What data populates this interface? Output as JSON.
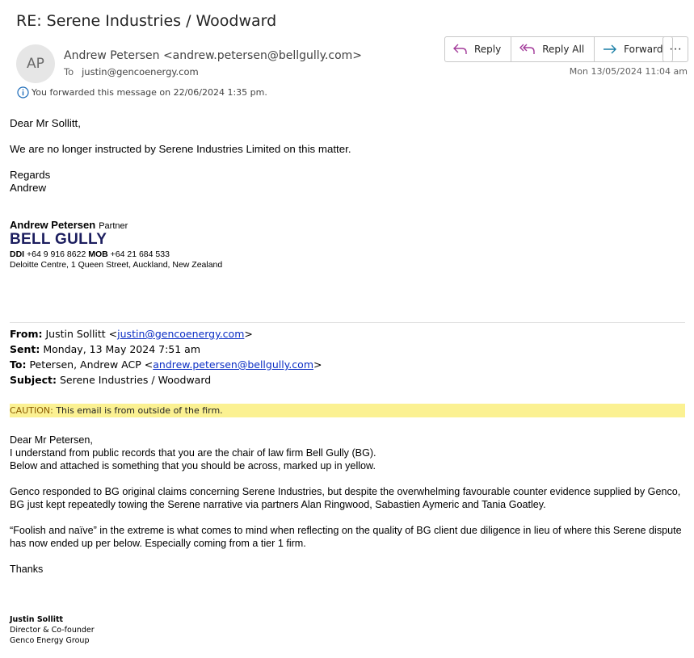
{
  "email": {
    "subject": "RE: Serene Industries / Woodward",
    "avatar_initials": "AP",
    "sender": "Andrew Petersen <andrew.petersen@bellgully.com>",
    "to_label": "To",
    "to": "justin@gencoenergy.com",
    "date": "Mon 13/05/2024 11:04 am",
    "info": "You forwarded this message on 22/06/2024 1:35 pm."
  },
  "toolbar": {
    "reply": "Reply",
    "reply_all": "Reply All",
    "forward": "Forward",
    "more": "···"
  },
  "body": {
    "greeting": "Dear Mr Sollitt,",
    "line1": "We are no longer instructed by Serene Industries Limited on this matter.",
    "regards": "Regards",
    "name": "Andrew"
  },
  "signature": {
    "name": "Andrew Petersen",
    "role": "Partner",
    "brand": "BELL GULLY",
    "ddi_label": "DDI",
    "ddi": "+64 9 916 8622",
    "mob_label": "MOB",
    "mob": "+64 21 684 533",
    "address": "Deloitte Centre, 1 Queen Street, Auckland, New Zealand"
  },
  "quoted": {
    "from_label": "From:",
    "from_name": "Justin Sollitt <",
    "from_email": "justin@gencoenergy.com",
    "from_end": ">",
    "sent_label": "Sent:",
    "sent": "Monday, 13 May 2024 7:51 am",
    "to_label": "To:",
    "to_name": "Petersen, Andrew ACP <",
    "to_email": "andrew.petersen@bellgully.com",
    "to_end": ">",
    "subject_label": "Subject:",
    "subject": "Serene Industries / Woodward"
  },
  "caution": {
    "label": "CAUTION:",
    "text": "This email is from outside of the firm."
  },
  "quoted_body": {
    "greeting": "Dear Mr Petersen,",
    "p1a": "I understand from public records that you are the chair of law firm Bell Gully (BG).",
    "p1b": "Below and attached is something that you should be across, marked up in yellow.",
    "p2": "Genco responded to BG original claims concerning Serene Industries, but despite the overwhelming favourable counter evidence supplied by Genco, BG just kept repeatedly towing the Serene narrative via partners Alan Ringwood, Sabastien Aymeric and Tania Goatley.",
    "p3": "“Foolish and naïve” in the extreme is what comes to mind when reflecting on the quality of BG client due diligence in lieu of where this Serene dispute has now ended up per below.  Especially coming from a tier 1 firm.",
    "thanks": "Thanks"
  },
  "quoted_signature": {
    "name": "Justin Sollitt",
    "title": "Director & Co-founder",
    "company": "Genco Energy Group"
  }
}
